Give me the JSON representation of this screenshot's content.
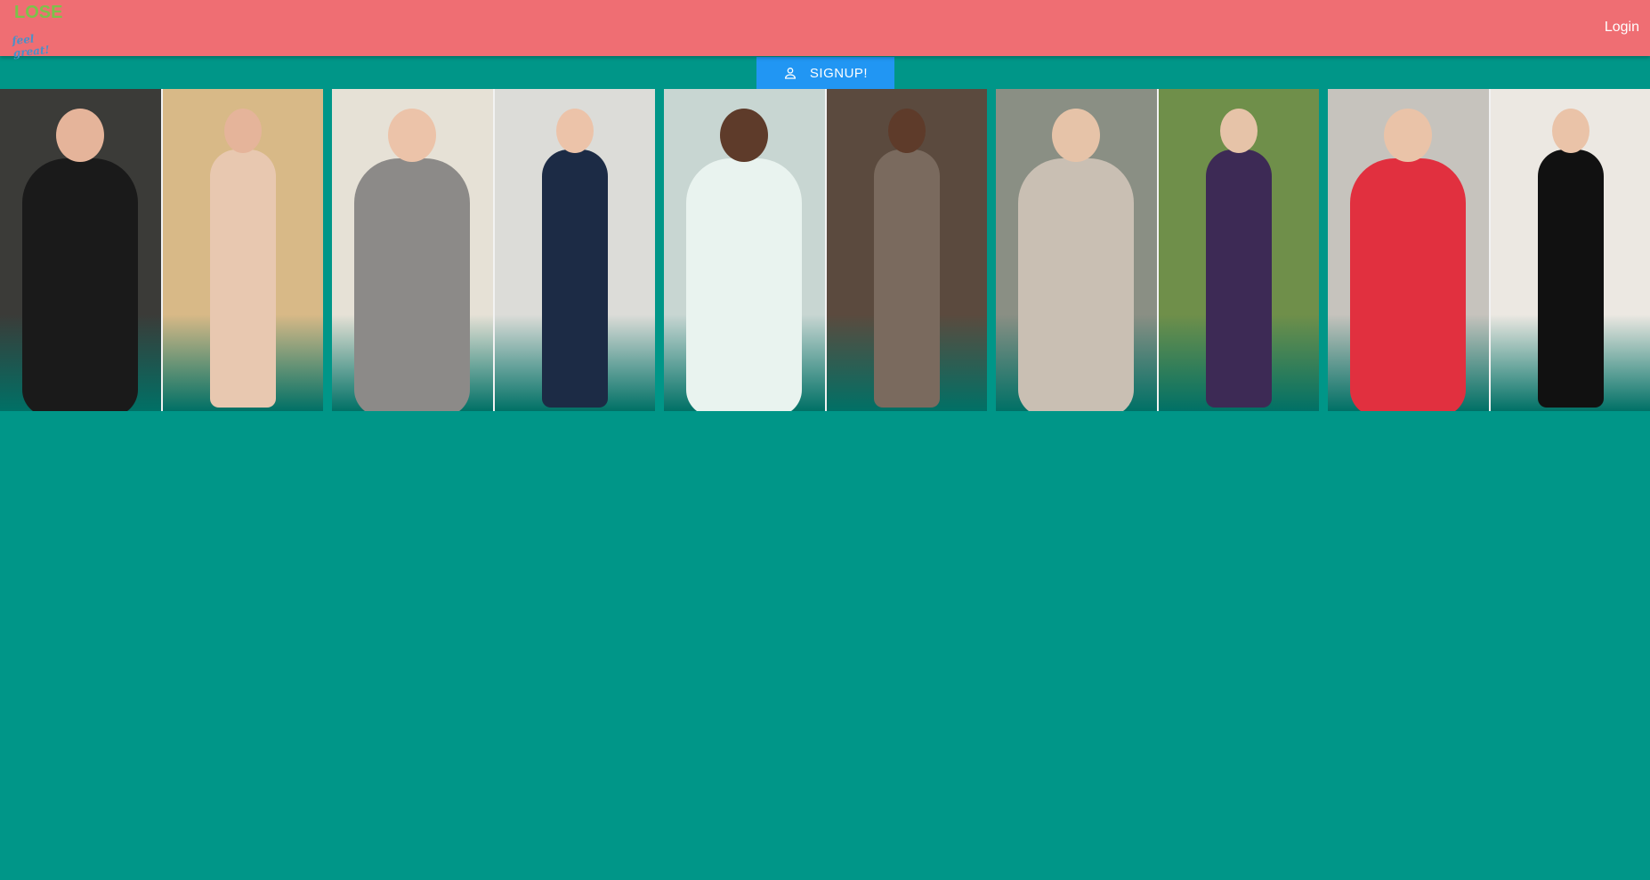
{
  "header": {
    "logo": {
      "line1": "LOSE",
      "line2": "feel great!"
    },
    "login_label": "Login"
  },
  "signup_label": "SIGNUP!",
  "gallery": [
    {
      "before_bg": "#3b3b38",
      "after_bg": "#d8b987",
      "before_figure": "#1a1a1a",
      "after_figure": "#e8c8b0",
      "skin": "#e5b49a"
    },
    {
      "before_bg": "#e6e1d6",
      "after_bg": "#dcdcd8",
      "before_figure": "#8c8a88",
      "after_figure": "#1c2b45",
      "skin": "#ecc3a9"
    },
    {
      "before_bg": "#c8d6d2",
      "after_bg": "#5b4a3e",
      "before_figure": "#e9f3ef",
      "after_figure": "#7a6a5e",
      "skin": "#5e3b2a"
    },
    {
      "before_bg": "#8a8f84",
      "after_bg": "#6f8f4a",
      "before_figure": "#c9bfb3",
      "after_figure": "#3d2a55",
      "skin": "#e6c3a8"
    },
    {
      "before_bg": "#c6c3bd",
      "after_bg": "#ece8e2",
      "before_figure": "#e1303f",
      "after_figure": "#111111",
      "skin": "#eac3a8"
    }
  ]
}
